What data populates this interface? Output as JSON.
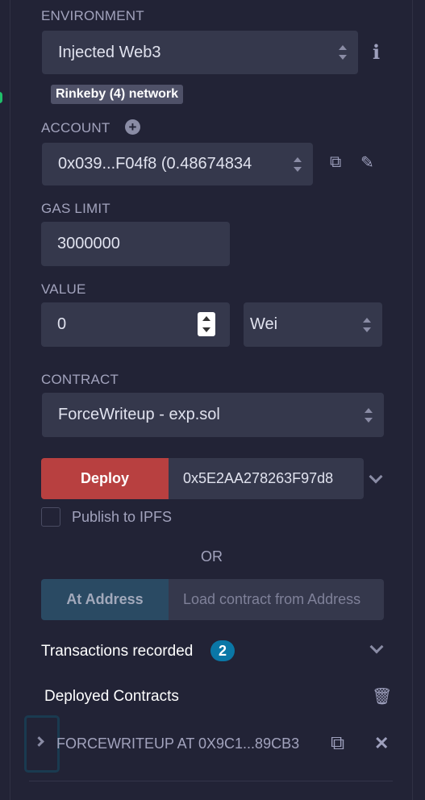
{
  "environment": {
    "label": "ENVIRONMENT",
    "value": "Injected Web3",
    "network_badge": "Rinkeby (4) network"
  },
  "account": {
    "label": "ACCOUNT",
    "value": "0x039...F04f8 (0.48674834"
  },
  "gas_limit": {
    "label": "GAS LIMIT",
    "value": "3000000"
  },
  "value": {
    "label": "VALUE",
    "amount": "0",
    "unit": "Wei"
  },
  "contract": {
    "label": "CONTRACT",
    "value": "ForceWriteup - exp.sol"
  },
  "deploy": {
    "button": "Deploy",
    "args": "0x5E2AA278263F97d8",
    "publish_label": "Publish to IPFS",
    "publish_checked": false
  },
  "or_label": "OR",
  "at_address": {
    "button": "At Address",
    "placeholder": "Load contract from Address"
  },
  "transactions": {
    "label": "Transactions recorded",
    "count": "2"
  },
  "deployed": {
    "label": "Deployed Contracts",
    "items": [
      {
        "name": "FORCEWRITEUP AT 0X9C1...89CB3"
      }
    ]
  },
  "colors": {
    "deploy": "#b84040",
    "at_address": "#2a4a63",
    "badge": "#0a77a6"
  }
}
